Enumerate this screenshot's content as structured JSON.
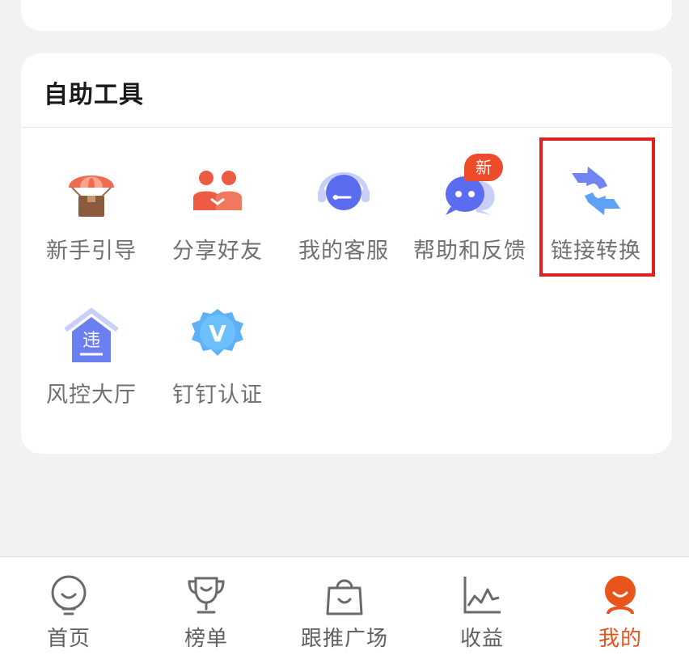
{
  "section": {
    "title": "自助工具"
  },
  "tools": [
    {
      "label": "新手引导",
      "icon": "parachute-box-icon"
    },
    {
      "label": "分享好友",
      "icon": "friends-icon"
    },
    {
      "label": "我的客服",
      "icon": "headset-icon"
    },
    {
      "label": "帮助和反馈",
      "icon": "chat-bubble-icon",
      "badge": "新"
    },
    {
      "label": "链接转换",
      "icon": "convert-arrows-icon"
    },
    {
      "label": "风控大厅",
      "icon": "risk-house-icon",
      "glyph": "违"
    },
    {
      "label": "钉钉认证",
      "icon": "dingtalk-badge-icon",
      "glyph": "V"
    }
  ],
  "tabs": [
    {
      "label": "首页",
      "icon": "home-face-icon"
    },
    {
      "label": "榜单",
      "icon": "trophy-icon"
    },
    {
      "label": "跟推广场",
      "icon": "shopping-bag-icon"
    },
    {
      "label": "收益",
      "icon": "earnings-chart-icon"
    },
    {
      "label": "我的",
      "icon": "profile-face-icon",
      "active": true
    }
  ],
  "colors": {
    "accent": "#e8541c",
    "highlight": "#e02020",
    "badge": "#ee4b2b",
    "icon_blue": "#6b7ff0"
  }
}
